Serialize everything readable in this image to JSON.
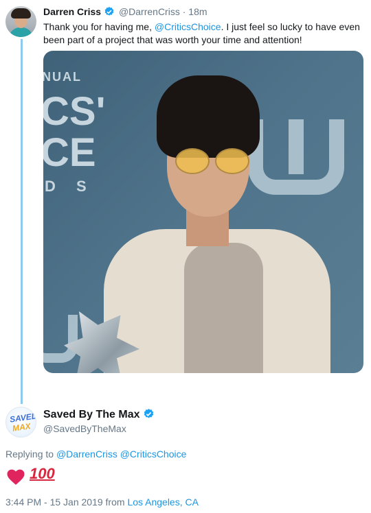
{
  "original_tweet": {
    "author_name": "Darren Criss",
    "handle": "@DarrenCriss",
    "separator": "·",
    "time_ago": "18m",
    "text_before_mention": "Thank you for having me, ",
    "mention": "@CriticsChoice",
    "text_after_mention": ". I just feel so lucky to have even been part of a project that was worth your time and attention!",
    "photo": {
      "backdrop_text_1": "NUAL",
      "backdrop_text_2": "CS'",
      "backdrop_text_3": "CE",
      "backdrop_text_4": "D S",
      "backdrop_text_5": "W"
    }
  },
  "reply_tweet": {
    "author_name": "Saved By The Max",
    "handle": "@SavedByTheMax",
    "avatar_text_1": "SAVED",
    "avatar_text_2": "MAX",
    "replying_to_label": "Replying to ",
    "replying_to_1": "@DarrenCriss",
    "replying_to_2": "@CriticsChoice",
    "emoji_names": [
      "red-heart",
      "hundred-points"
    ],
    "hundred_text": "100",
    "timestamp": "3:44 PM - 15 Jan 2019",
    "from_label": " from ",
    "location": "Los Angeles, CA"
  },
  "colors": {
    "link": "#1b95e0",
    "verified": "#1da1f2",
    "thread_line": "#8ec9ef",
    "muted_text": "#657786",
    "heart": "#e0245e"
  }
}
